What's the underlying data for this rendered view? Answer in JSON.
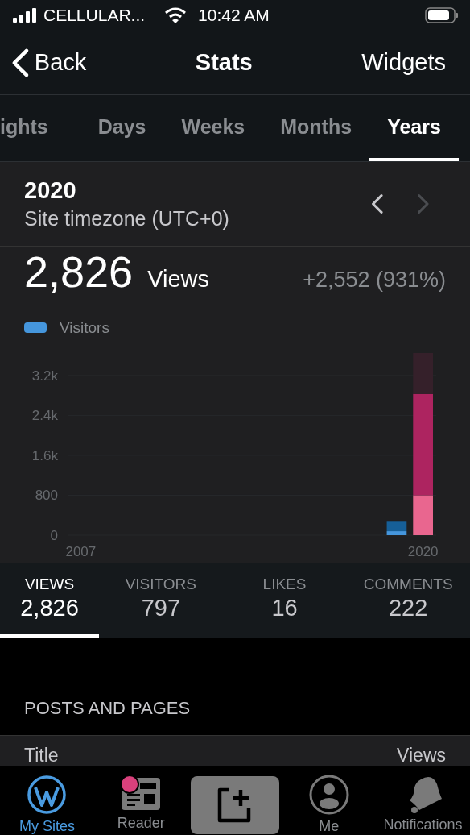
{
  "status_bar": {
    "carrier": "CELLULAR...",
    "time": "10:42 AM"
  },
  "nav": {
    "back": "Back",
    "title": "Stats",
    "action": "Widgets"
  },
  "period_tabs": [
    {
      "label": "ights",
      "selected": false
    },
    {
      "label": "Days",
      "selected": false
    },
    {
      "label": "Weeks",
      "selected": false
    },
    {
      "label": "Months",
      "selected": false
    },
    {
      "label": "Years",
      "selected": true
    }
  ],
  "period": {
    "title": "2020",
    "subtitle": "Site timezone (UTC+0)",
    "prev_disabled": false,
    "next_disabled": true
  },
  "summary": {
    "value": "2,826",
    "unit": "Views",
    "change": "+2,552 (931%)"
  },
  "chart": {
    "chart_data": {
      "type": "bar",
      "grid": true,
      "stacked": true,
      "x": [
        2019,
        2020
      ],
      "series": [
        {
          "name": "Visitors",
          "color": "#4596dd",
          "values": [
            80,
            null
          ]
        },
        {
          "color": "#165f98",
          "values": [
            190,
            null
          ]
        },
        {
          "color": "#e9668f",
          "values": [
            null,
            800
          ]
        },
        {
          "color": "#ad2460",
          "values": [
            null,
            2030
          ]
        },
        {
          "color": "#35202a",
          "values": [
            null,
            820
          ]
        }
      ],
      "xlim": [
        2006.5,
        2020.5
      ],
      "xticks": [
        2007,
        2020
      ],
      "ylim": [
        0,
        3650
      ],
      "yticks": [
        0,
        800,
        {
          "value": 1600,
          "label": "1.6k"
        },
        {
          "value": 2400,
          "label": "2.4k"
        },
        {
          "value": 3200,
          "label": "3.2k"
        }
      ]
    }
  },
  "stat_tabs": [
    {
      "label": "VIEWS",
      "value": "2,826",
      "selected": true
    },
    {
      "label": "VISITORS",
      "value": "797",
      "selected": false
    },
    {
      "label": "LIKES",
      "value": "16",
      "selected": false
    },
    {
      "label": "COMMENTS",
      "value": "222",
      "selected": false
    }
  ],
  "posts": {
    "heading": "POSTS AND PAGES",
    "columns": [
      "Title",
      "Views"
    ]
  },
  "tab_bar": [
    {
      "kind": "sites",
      "label": "My Sites",
      "selected": true,
      "badge": false
    },
    {
      "kind": "reader",
      "label": "Reader",
      "selected": false,
      "badge": true
    },
    {
      "kind": "write",
      "selected": false
    },
    {
      "kind": "me",
      "label": "Me",
      "selected": false,
      "badge": false
    },
    {
      "kind": "notifications",
      "label": "Notifications",
      "selected": false,
      "badge": false
    }
  ]
}
